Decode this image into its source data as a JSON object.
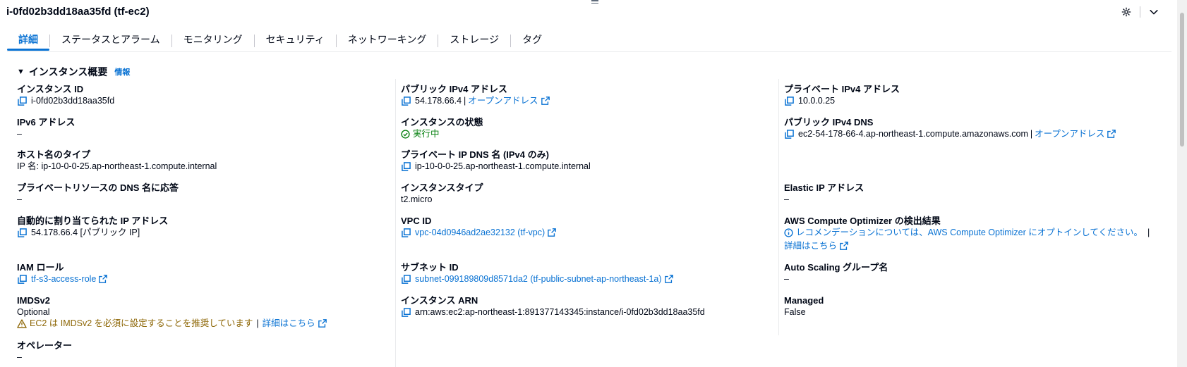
{
  "header": {
    "title": "i-0fd02b3dd18aa35fd (tf-ec2)"
  },
  "tabs": [
    {
      "label": "詳細"
    },
    {
      "label": "ステータスとアラーム"
    },
    {
      "label": "モニタリング"
    },
    {
      "label": "セキュリティ"
    },
    {
      "label": "ネットワーキング"
    },
    {
      "label": "ストレージ"
    },
    {
      "label": "タグ"
    }
  ],
  "section": {
    "title": "インスタンス概要",
    "info": "情報"
  },
  "col1": {
    "instance_id": {
      "label": "インスタンス ID",
      "value": "i-0fd02b3dd18aa35fd"
    },
    "ipv6": {
      "label": "IPv6 アドレス",
      "value": "–"
    },
    "hostname_type": {
      "label": "ホスト名のタイプ",
      "value": "IP 名: ip-10-0-0-25.ap-northeast-1.compute.internal"
    },
    "private_dns_answer": {
      "label": "プライベートリソースの DNS 名に応答",
      "value": "–"
    },
    "auto_ip": {
      "label": "自動的に割り当てられた IP アドレス",
      "value": "54.178.66.4 [パブリック IP]"
    },
    "iam_role": {
      "label": "IAM ロール",
      "value": "tf-s3-access-role"
    },
    "imdsv2": {
      "label": "IMDSv2",
      "value": "Optional",
      "warning": "EC2 は IMDSv2 を必須に設定することを推奨しています",
      "sep": "|",
      "more": "詳細はこちら"
    },
    "operator": {
      "label": "オペレーター",
      "value": "–"
    }
  },
  "col2": {
    "public_ipv4": {
      "label": "パブリック IPv4 アドレス",
      "value": "54.178.66.4",
      "sep": "|",
      "open": "オープンアドレス"
    },
    "state": {
      "label": "インスタンスの状態",
      "value": "実行中"
    },
    "private_ip_dns": {
      "label": "プライベート IP DNS 名 (IPv4 のみ)",
      "value": "ip-10-0-0-25.ap-northeast-1.compute.internal"
    },
    "instance_type": {
      "label": "インスタンスタイプ",
      "value": "t2.micro"
    },
    "vpc": {
      "label": "VPC ID",
      "value": "vpc-04d0946ad2ae32132 (tf-vpc)"
    },
    "subnet": {
      "label": "サブネット ID",
      "value": "subnet-099189809d8571da2 (tf-public-subnet-ap-northeast-1a)"
    },
    "arn": {
      "label": "インスタンス ARN",
      "value": "arn:aws:ec2:ap-northeast-1:891377143345:instance/i-0fd02b3dd18aa35fd"
    }
  },
  "col3": {
    "private_ipv4": {
      "label": "プライベート IPv4 アドレス",
      "value": "10.0.0.25"
    },
    "public_dns": {
      "label": "パブリック IPv4 DNS",
      "value": "ec2-54-178-66-4.ap-northeast-1.compute.amazonaws.com",
      "sep": "|",
      "open": "オープンアドレス"
    },
    "elastic_ip": {
      "label": "Elastic IP アドレス",
      "value": "–"
    },
    "optimizer": {
      "label": "AWS Compute Optimizer の検出結果",
      "value": "レコメンデーションについては、AWS Compute Optimizer にオプトインしてください。",
      "sep": "|",
      "more": "詳細はこちら"
    },
    "asg": {
      "label": "Auto Scaling グループ名",
      "value": "–"
    },
    "managed": {
      "label": "Managed",
      "value": "False"
    }
  },
  "colors": {
    "link": "#0972d3",
    "success": "#037f0c",
    "warning": "#8d6605",
    "text": "#000716"
  },
  "icons": [
    "drag-handle-icon",
    "settings-icon",
    "chevron-down-icon",
    "caret-down-icon",
    "copy-icon",
    "external-link-icon",
    "status-ok-icon",
    "warning-icon",
    "info-icon"
  ]
}
